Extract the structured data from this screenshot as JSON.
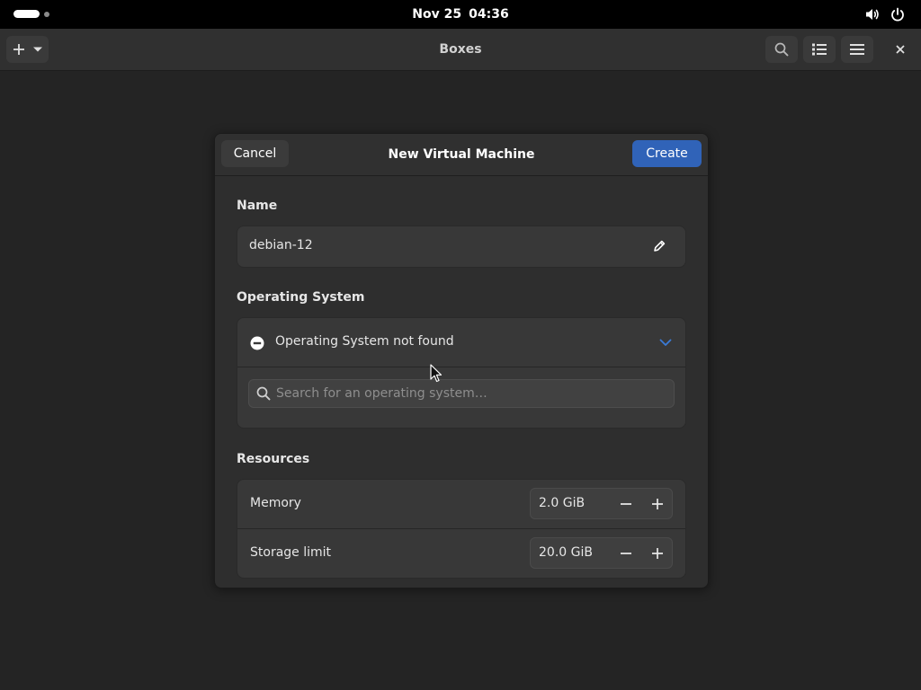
{
  "topbar": {
    "date": "Nov 25",
    "time": "04:36"
  },
  "app": {
    "title": "Boxes"
  },
  "dialog": {
    "title": "New Virtual Machine",
    "cancel_label": "Cancel",
    "create_label": "Create",
    "name_section": {
      "label": "Name",
      "value": "debian-12"
    },
    "os_section": {
      "label": "Operating System",
      "selected": "Operating System not found",
      "search_placeholder": "Search for an operating system…"
    },
    "resources_section": {
      "label": "Resources",
      "rows": [
        {
          "label": "Memory",
          "value": "2.0 GiB"
        },
        {
          "label": "Storage limit",
          "value": "20.0 GiB"
        }
      ]
    }
  },
  "colors": {
    "accent": "#3063b8",
    "background": "#242424",
    "dialog": "#2e2e2e",
    "card": "#383838"
  },
  "icons": {
    "new": "plus-icon",
    "menu_dropdown": "chevron-down-icon",
    "search": "search-icon",
    "view": "list-view-icon",
    "main_menu": "hamburger-menu-icon",
    "close": "close-icon",
    "edit": "pencil-icon",
    "os_status": "minus-circle-icon",
    "volume": "volume-icon",
    "power": "power-icon"
  }
}
